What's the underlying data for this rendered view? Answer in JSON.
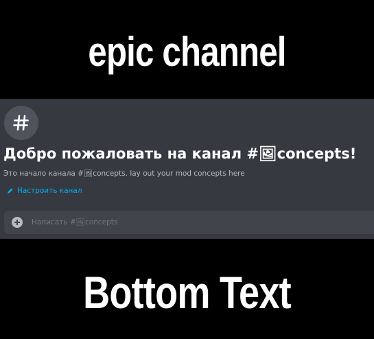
{
  "meme": {
    "top_text": "epic channel",
    "bottom_text": "Bottom Text"
  },
  "channel": {
    "hash_icon": "hash-icon",
    "welcome_title": "Добро пожаловать на канал #🖼concepts!",
    "welcome_subtitle": "Это начало канала #🖼concepts. lay out your mod concepts here",
    "edit_label": "Настроить канал",
    "edit_icon": "pencil-icon"
  },
  "composer": {
    "add_icon": "plus-circle-icon",
    "placeholder": "Написать #🖼concepts"
  },
  "colors": {
    "panel_bg": "#36393f",
    "link": "#00b0f4",
    "input_bg": "#40444b"
  }
}
